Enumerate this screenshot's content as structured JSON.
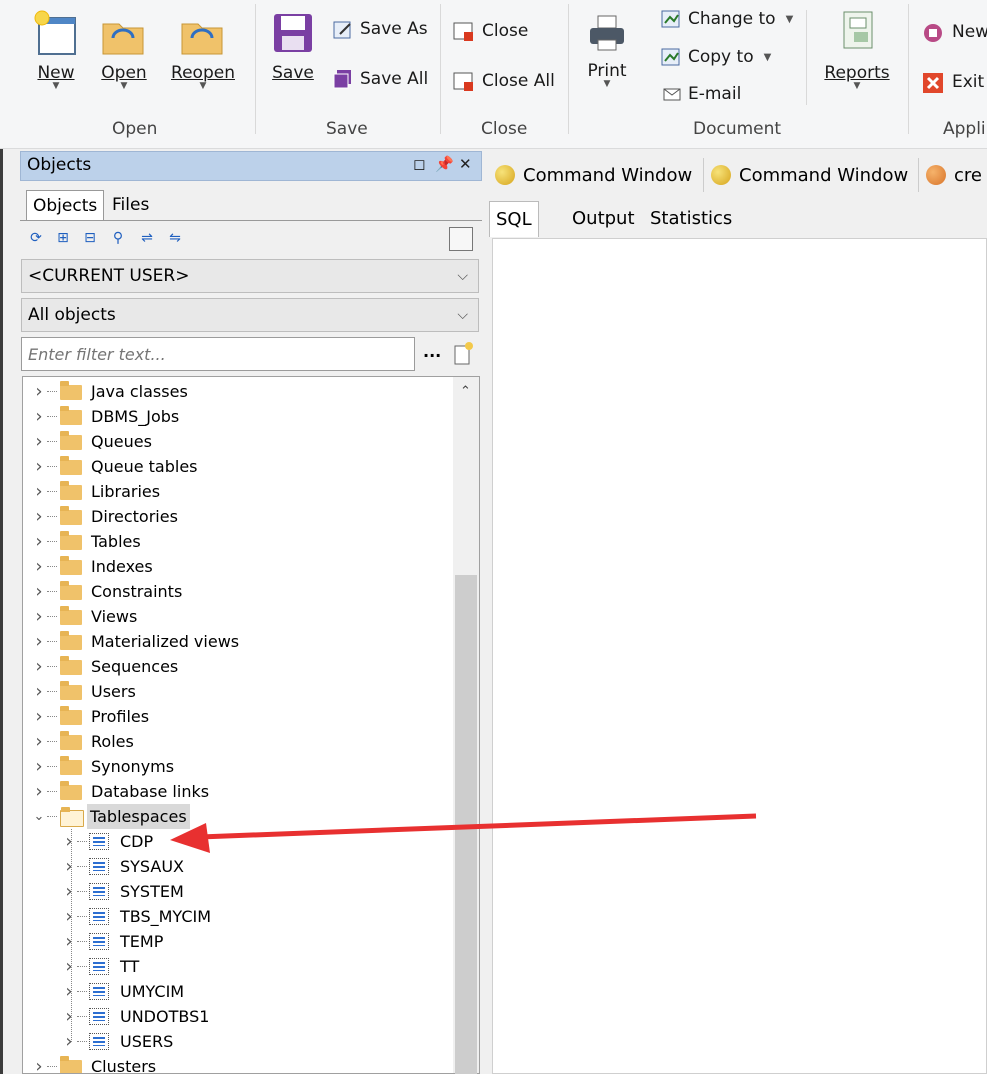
{
  "ribbon": {
    "file_group": {
      "label": "Open",
      "new": "New",
      "open": "Open",
      "reopen": "Reopen"
    },
    "save_group": {
      "label": "Save",
      "save": "Save",
      "save_as": "Save As",
      "save_all": "Save All"
    },
    "close_group": {
      "label": "Close",
      "close": "Close",
      "close_all": "Close All"
    },
    "document_group": {
      "label": "Document",
      "print": "Print",
      "change_to": "Change to",
      "copy_to": "Copy to",
      "email": "E-mail",
      "reports": "Reports"
    },
    "app_group": {
      "label": "Appli",
      "new": "New",
      "exit": "Exit"
    }
  },
  "objects_panel": {
    "title": "Objects",
    "tabs": [
      "Objects",
      "Files"
    ],
    "user_combo": "<CURRENT USER>",
    "type_combo": "All objects",
    "filter_placeholder": "Enter filter text...",
    "filter_more": "...",
    "tree": {
      "folders_before": [
        "Java classes",
        "DBMS_Jobs",
        "Queues",
        "Queue tables",
        "Libraries",
        "Directories",
        "Tables",
        "Indexes",
        "Constraints",
        "Views",
        "Materialized views",
        "Sequences",
        "Users",
        "Profiles",
        "Roles",
        "Synonyms",
        "Database links"
      ],
      "expanded_folder": "Tablespaces",
      "tablespaces": [
        "CDP",
        "SYSAUX",
        "SYSTEM",
        "TBS_MYCIM",
        "TEMP",
        "TT",
        "UMYCIM",
        "UNDOTBS1",
        "USERS"
      ],
      "folders_after": [
        "Clusters"
      ]
    }
  },
  "doc_tabs": [
    "Command Window",
    "Command Window",
    "cre"
  ],
  "editor_tabs": [
    "SQL",
    "Output",
    "Statistics"
  ],
  "annotation": {
    "arrow_color": "#e83030"
  }
}
